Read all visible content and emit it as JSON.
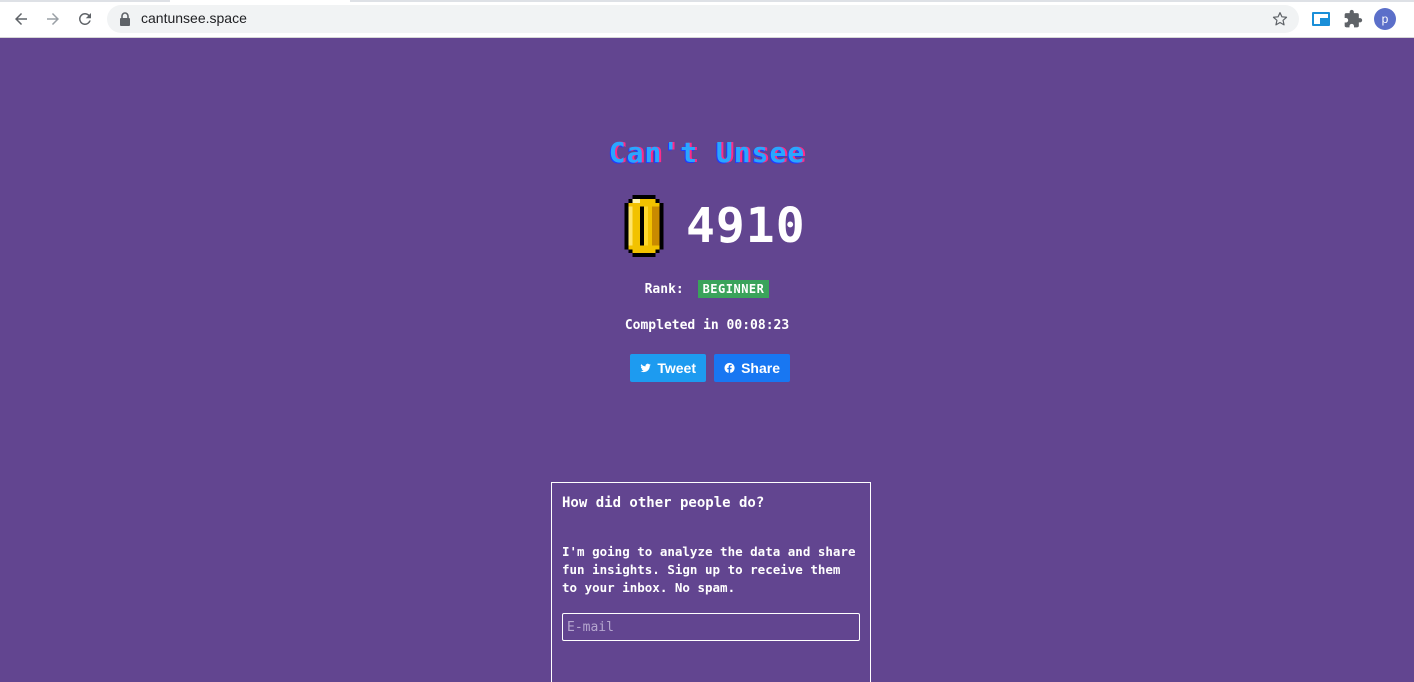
{
  "browser": {
    "url": "cantunsee.space",
    "profile_initial": "p"
  },
  "game": {
    "title": "Can't Unsee",
    "score": "4910",
    "rank_label": "Rank:",
    "rank_value": "BEGINNER",
    "completed_text": "Completed in 00:08:23"
  },
  "share": {
    "tweet_label": "Tweet",
    "share_label": "Share"
  },
  "signup": {
    "title": "How did other people do?",
    "description": "I'm going to analyze the data and share fun insights. Sign up to receive them to your inbox. No spam.",
    "email_placeholder": "E-mail"
  },
  "colors": {
    "background": "#624590",
    "rank_badge": "#3aa35b",
    "tweet_button": "#1d9bf0",
    "share_button": "#1877f2"
  },
  "icons": {
    "back": "back-arrow-icon",
    "forward": "forward-arrow-icon",
    "reload": "reload-icon",
    "lock": "lock-icon",
    "bookmark": "star-icon",
    "extension1": "picture-in-picture-icon",
    "extensions": "puzzle-icon",
    "coin": "coin-icon",
    "twitter": "twitter-bird-icon",
    "facebook": "facebook-icon"
  }
}
